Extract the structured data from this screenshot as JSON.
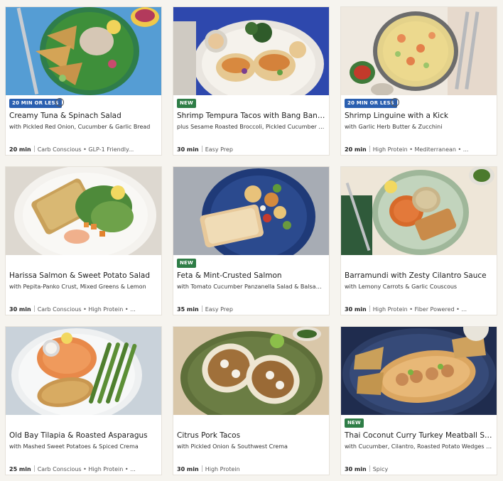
{
  "cards": [
    {
      "badge": "20 MIN OR LESS",
      "title": "Creamy Tuna & Spinach Salad",
      "subtitle": "with Pickled Red Onion, Cucumber & Garlic Bread",
      "time": "20 min",
      "tags": "Carb Conscious • GLP-1 Friendly..."
    },
    {
      "badge": "NEW",
      "title": "Shrimp Tempura Tacos with Bang Bang ...",
      "subtitle": "plus Sesame Roasted Broccoli, Pickled Cucumber & ...",
      "time": "30 min",
      "tags": "Easy Prep"
    },
    {
      "badge": "20 MIN OR LESS",
      "title": "Shrimp Linguine with a Kick",
      "subtitle": "with Garlic Herb Butter & Zucchini",
      "time": "20 min",
      "tags": "High Protein • Mediterranean • ..."
    },
    {
      "badge": "",
      "title": "Harissa Salmon & Sweet Potato Salad",
      "subtitle": "with Pepita-Panko Crust, Mixed Greens & Lemon",
      "time": "30 min",
      "tags": "Carb Conscious • High Protein • ..."
    },
    {
      "badge": "NEW",
      "title": "Feta & Mint-Crusted Salmon",
      "subtitle": "with Tomato Cucumber Panzanella Salad & Balsamic...",
      "time": "35 min",
      "tags": "Easy Prep"
    },
    {
      "badge": "",
      "title": "Barramundi with Zesty Cilantro Sauce",
      "subtitle": "with Lemony Carrots & Garlic Couscous",
      "time": "30 min",
      "tags": "High Protein • Fiber Powered • ..."
    },
    {
      "badge": "",
      "title": "Old Bay Tilapia & Roasted Asparagus",
      "subtitle": "with Mashed Sweet Potatoes & Spiced Crema",
      "time": "25 min",
      "tags": "Carb Conscious • High Protein • ..."
    },
    {
      "badge": "",
      "title": "Citrus Pork Tacos",
      "subtitle": "with Pickled Onion & Southwest Crema",
      "time": "30 min",
      "tags": "High Protein"
    },
    {
      "badge": "NEW",
      "title": "Thai Coconut Curry Turkey Meatball San...",
      "subtitle": "with Cucumber, Cilantro, Roasted Potato Wedges & ...",
      "time": "30 min",
      "tags": "Spicy"
    }
  ],
  "info_symbol": "i",
  "colors": {
    "quick_badge": "#2a5fb0",
    "new_badge": "#2e7d46",
    "page_bg": "#f6f4ef"
  }
}
